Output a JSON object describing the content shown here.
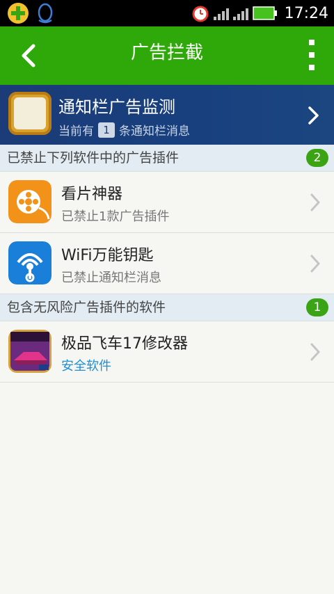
{
  "status_bar": {
    "time": "17:24",
    "icons": [
      "plus-app-icon",
      "qq-penguin-icon",
      "alarm-clock-icon",
      "signal-icon",
      "signal-icon",
      "battery-icon"
    ]
  },
  "app_bar": {
    "title": "广告拦截",
    "back_icon": "back-chevron-icon",
    "menu_icon": "overflow-menu-icon"
  },
  "notification_banner": {
    "title": "通知栏广告监测",
    "sub_prefix": "当前有",
    "count": "1",
    "sub_suffix": "条通知栏消息"
  },
  "sections": [
    {
      "label": "已禁止下列软件中的广告插件",
      "badge": "2",
      "items": [
        {
          "name": "看片神器",
          "desc": "已禁止1款广告插件",
          "icon": "video-reel-icon"
        },
        {
          "name": "WiFi万能钥匙",
          "desc": "已禁止通知栏消息",
          "icon": "wifi-key-icon"
        }
      ]
    },
    {
      "label": "包含无风险广告插件的软件",
      "badge": "1",
      "items": [
        {
          "name": "极品飞车17修改器",
          "desc": "安全软件",
          "icon": "racing-game-icon"
        }
      ]
    }
  ],
  "colors": {
    "app_bar": "#2fa80a",
    "banner": "#1b3c78",
    "badge": "#3aa414",
    "safe_text": "#1d8fd6"
  }
}
